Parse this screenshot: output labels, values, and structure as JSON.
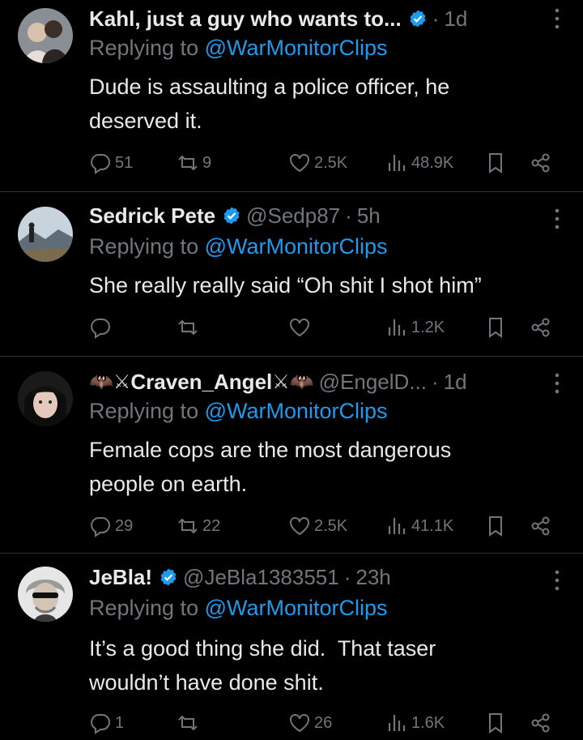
{
  "tweets": [
    {
      "name": "Kahl, just a guy who wants to...",
      "handle": "",
      "time": "1d",
      "replying_prefix": "Replying to ",
      "replying_to": "@WarMonitorClips",
      "text_lines": [
        "Dude is assaulting a police officer, he",
        "deserved it."
      ],
      "replies": "51",
      "retweets": "9",
      "likes": "2.5K",
      "views": "48.9K",
      "verified": true
    },
    {
      "name": "Sedrick Pete",
      "handle": "@Sedp87",
      "time": "5h",
      "replying_prefix": "Replying to ",
      "replying_to": "@WarMonitorClips",
      "text_lines": [
        "She really really said “Oh shit I shot him”"
      ],
      "replies": "",
      "retweets": "",
      "likes": "",
      "views": "1.2K",
      "verified": true
    },
    {
      "name": "Craven_Angel",
      "name_left_decor": "🦇⚔",
      "name_right_decor": "⚔🦇",
      "handle": "@EngelD...",
      "time": "1d",
      "replying_prefix": "Replying to ",
      "replying_to": "@WarMonitorClips",
      "text_lines": [
        "Female cops are the most dangerous",
        "people on earth."
      ],
      "replies": "29",
      "retweets": "22",
      "likes": "2.5K",
      "views": "41.1K",
      "verified": false
    },
    {
      "name": "JeBla!",
      "handle": "@JeBla1383551",
      "time": "23h",
      "replying_prefix": "Replying to ",
      "replying_to": "@WarMonitorClips",
      "text_lines": [
        "It’s a good thing she did.  That taser",
        "wouldn’t have done shit."
      ],
      "replies": "1",
      "retweets": "",
      "likes": "26",
      "views": "1.6K",
      "verified": true
    }
  ],
  "separator": "·",
  "colors": {
    "background": "#000000",
    "text": "#e7e9ea",
    "muted": "#71767b",
    "link": "#1d9bf0",
    "divider": "#2f3336"
  },
  "icons": [
    "reply-icon",
    "retweet-icon",
    "like-icon",
    "views-icon",
    "bookmark-icon",
    "share-icon",
    "more-icon",
    "verified-badge-icon"
  ]
}
